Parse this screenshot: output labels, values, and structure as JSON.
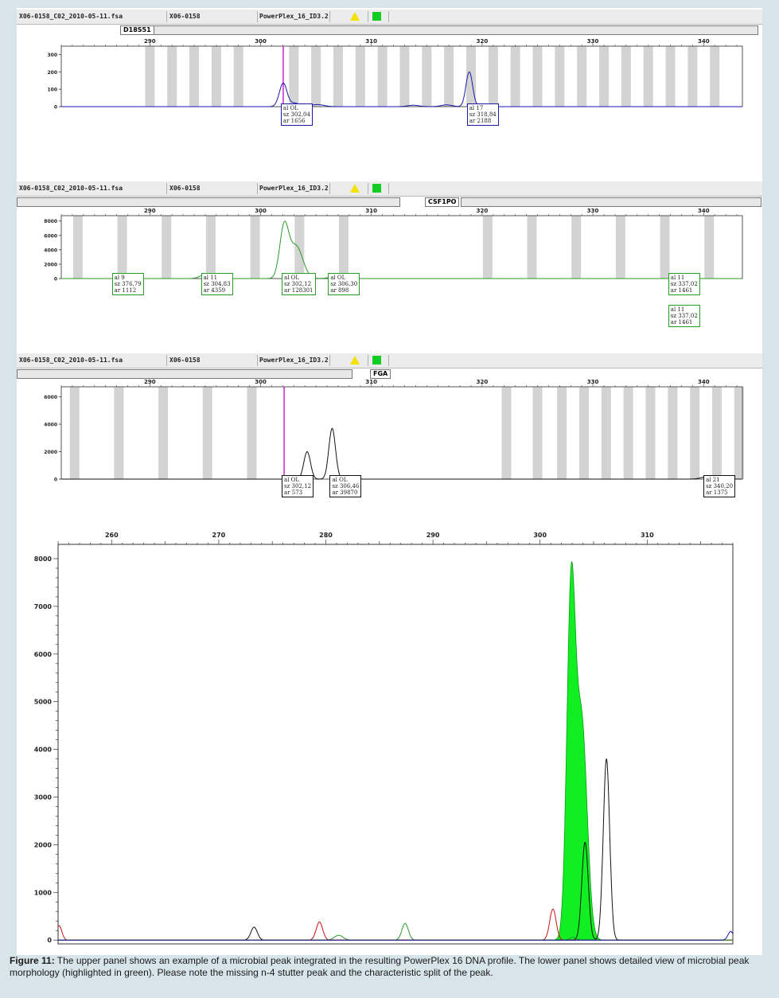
{
  "headers": [
    {
      "file": "X06-0158_C02_2010-05-11.fsa",
      "sample": "X06-0158",
      "kit": "PowerPlex_16_ID3.2"
    },
    {
      "file": "X06-0158_C02_2010-05-11.fsa",
      "sample": "X06-0158",
      "kit": "PowerPlex_16_ID3.2"
    },
    {
      "file": "X06-0158_C02_2010-05-11.fsa",
      "sample": "X06-0158",
      "kit": "PowerPlex_16_ID3.2"
    }
  ],
  "colors": {
    "blue": "#1a1aa8",
    "green": "#2a9a2a",
    "black": "#111111",
    "red": "#cc1111",
    "magenta": "#cc22cc",
    "bin": "#d3d3d3",
    "microbial": "#11ee22",
    "background": "#d7e5ea"
  },
  "chart_data": [
    {
      "type": "line",
      "locus": "D18S51",
      "dye": "blue",
      "xlim": [
        282,
        343.5
      ],
      "xticks": [
        290,
        300,
        310,
        320,
        330,
        340
      ],
      "ylim": [
        0,
        330
      ],
      "yticks": [
        0,
        100,
        200,
        300
      ],
      "bins": [
        290,
        292,
        294,
        296,
        298,
        303,
        305,
        307,
        309,
        311,
        313,
        315,
        317,
        319,
        321,
        323,
        325,
        327,
        329,
        331,
        333,
        335,
        337,
        339,
        341
      ],
      "peaks": [
        {
          "x": 302.04,
          "y": 135,
          "w": 0.35
        },
        {
          "x": 303.1,
          "y": 20,
          "w": 0.4
        },
        {
          "x": 305.1,
          "y": 12,
          "w": 0.6
        },
        {
          "x": 313.8,
          "y": 8,
          "w": 0.5
        },
        {
          "x": 316.8,
          "y": 10,
          "w": 0.5
        },
        {
          "x": 318.84,
          "y": 200,
          "w": 0.3
        }
      ],
      "marker_x": 302.04,
      "annotations": [
        {
          "x": 302.04,
          "lines": [
            "al OL",
            "sz 302,04",
            "ar 1656"
          ]
        },
        {
          "x": 318.84,
          "lines": [
            "al 17",
            "sz 318,84",
            "ar 2188"
          ]
        }
      ]
    },
    {
      "type": "line",
      "locus": "CSF1PO",
      "dye": "green",
      "xlim": [
        282,
        343.5
      ],
      "xticks": [
        290,
        300,
        310,
        320,
        330,
        340
      ],
      "ylim": [
        0,
        8300
      ],
      "yticks": [
        0,
        2000,
        4000,
        6000,
        8000
      ],
      "bins": [
        283.5,
        287.5,
        291.5,
        295.5,
        299.5,
        303.5,
        307.5,
        320.5,
        324.5,
        328.5,
        332.5,
        336.5,
        340.5
      ],
      "peaks": [
        {
          "x": 294.83,
          "y": 450,
          "w": 0.4
        },
        {
          "x": 302.12,
          "y": 7000,
          "w": 0.4
        },
        {
          "x": 303.2,
          "y": 4500,
          "w": 0.6
        },
        {
          "x": 306.3,
          "y": 150,
          "w": 0.4
        }
      ],
      "marker_x": null,
      "annotations": [
        {
          "x": 286.79,
          "lines": [
            "al 9",
            "sz 376,79",
            "ar 1112"
          ]
        },
        {
          "x": 294.83,
          "lines": [
            "al 11",
            "sz 304,83",
            "ar 4359"
          ]
        },
        {
          "x": 302.12,
          "lines": [
            "al OL",
            "sz 302,12",
            "ar 128301"
          ]
        },
        {
          "x": 306.3,
          "lines": [
            "al OL",
            "sz 306,30",
            "ar 898"
          ]
        },
        {
          "x": 337.02,
          "lines": [
            "al 11",
            "sz 337,02",
            "ar 1461"
          ]
        },
        {
          "x": 337.02,
          "lines": [
            "al 11",
            "sz 337,02",
            "ar 1461"
          ],
          "lower": true
        }
      ]
    },
    {
      "type": "line",
      "locus": "FGA",
      "dye": "black",
      "xlim": [
        282,
        343.5
      ],
      "xticks": [
        290,
        300,
        310,
        320,
        330,
        340
      ],
      "ylim": [
        0,
        6500
      ],
      "yticks": [
        0,
        2000,
        4000,
        6000
      ],
      "bins": [
        283.2,
        287.2,
        291.2,
        295.2,
        299.2,
        322.2,
        325,
        327.2,
        329.2,
        331.2,
        333.2,
        335.2,
        337.2,
        339.2,
        341.2,
        343.2
      ],
      "peaks": [
        {
          "x": 304.2,
          "y": 2000,
          "w": 0.3
        },
        {
          "x": 306.46,
          "y": 3700,
          "w": 0.3
        },
        {
          "x": 340.2,
          "y": 150,
          "w": 0.5
        }
      ],
      "marker_x": 302.12,
      "annotations": [
        {
          "x": 302.12,
          "lines": [
            "al OL",
            "sz 302,12",
            "ar 573"
          ]
        },
        {
          "x": 306.46,
          "lines": [
            "al OL",
            "sz 306,46",
            "ar 39870"
          ]
        },
        {
          "x": 340.2,
          "lines": [
            "al 21",
            "sz 340,20",
            "ar 1375"
          ]
        }
      ]
    },
    {
      "type": "area",
      "xlim": [
        255,
        318
      ],
      "xticks": [
        260,
        270,
        280,
        290,
        300,
        310
      ],
      "ylim": [
        -80,
        8300
      ],
      "yticks": [
        0,
        1000,
        2000,
        3000,
        4000,
        5000,
        6000,
        7000,
        8000
      ],
      "series": [
        {
          "color": "black",
          "peaks": [
            {
              "x": 273.3,
              "y": 270,
              "w": 0.3
            },
            {
              "x": 304.2,
              "y": 2050,
              "w": 0.3
            },
            {
              "x": 306.2,
              "y": 3800,
              "w": 0.3
            }
          ]
        },
        {
          "color": "red",
          "peaks": [
            {
              "x": 255.1,
              "y": 300,
              "w": 0.25
            },
            {
              "x": 279.4,
              "y": 380,
              "w": 0.3
            },
            {
              "x": 301.2,
              "y": 650,
              "w": 0.3
            }
          ]
        },
        {
          "color": "green",
          "peaks": [
            {
              "x": 281.2,
              "y": 100,
              "w": 0.4
            },
            {
              "x": 287.4,
              "y": 350,
              "w": 0.3
            },
            {
              "x": 303.1,
              "y": 60,
              "w": 0.3
            }
          ]
        },
        {
          "color": "blue",
          "peaks": [
            {
              "x": 317.8,
              "y": 180,
              "w": 0.25
            }
          ]
        }
      ],
      "microbial_peak": {
        "peaks": [
          {
            "x": 302.9,
            "y": 7250,
            "w": 0.4
          },
          {
            "x": 303.9,
            "y": 4500,
            "w": 0.5
          }
        ]
      }
    }
  ],
  "caption": {
    "label": "Figure 11:",
    "text": " The upper panel shows an example of a microbial peak integrated in the resulting PowerPlex 16 DNA profile. The lower panel shows detailed view of microbial peak morphology (highlighted in green). Please note the missing n-4 stutter peak and the characteristic split of the peak."
  }
}
